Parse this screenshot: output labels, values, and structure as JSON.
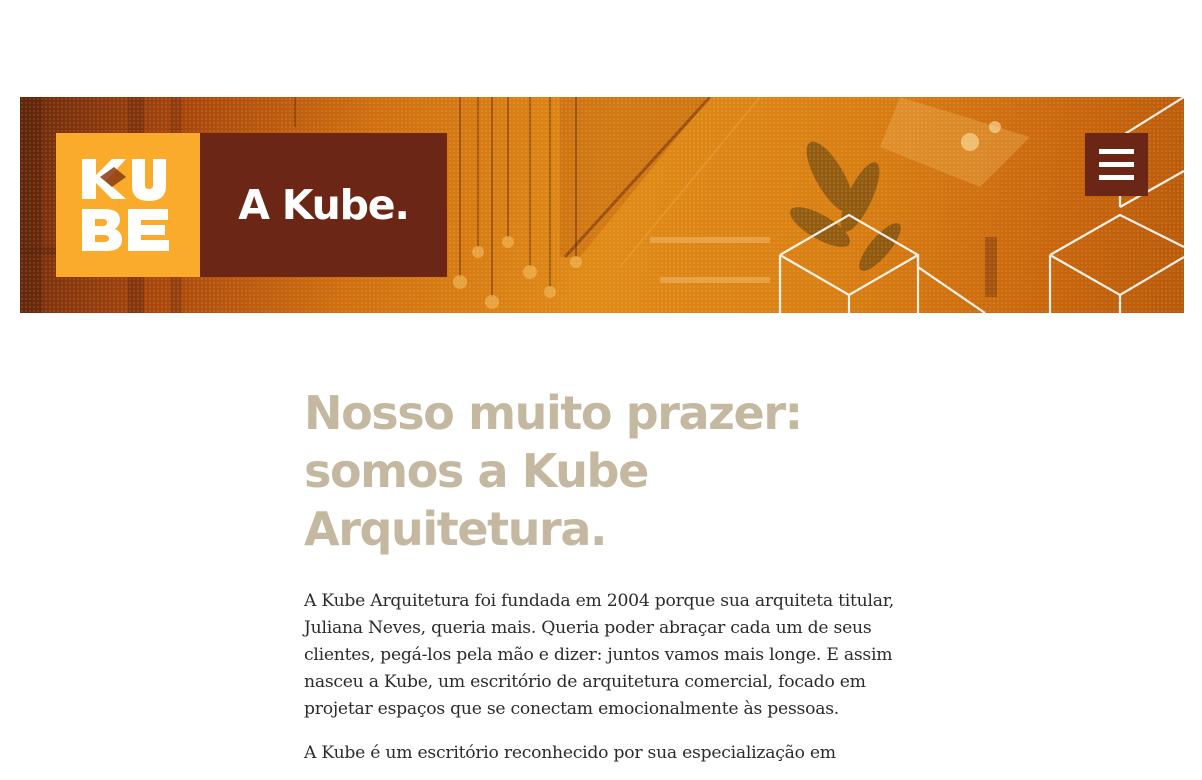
{
  "header": {
    "logo": {
      "alt_text": "KUBE",
      "line1": "KU",
      "line2": "BE"
    },
    "brand_title": "A Kube.",
    "menu_icon": "hamburger-menu-icon"
  },
  "main": {
    "heading_lines": [
      "Nosso muito prazer:",
      "somos a Kube",
      "Arquitetura."
    ],
    "paragraphs": [
      [
        "A Kube Arquitetura foi fundada em 2004 porque sua arquiteta titular,",
        "Juliana Neves, queria mais. Queria poder abraçar cada um de seus",
        "clientes, pegá-los pela mão e dizer: juntos vamos mais longe. E assim",
        "nasceu a Kube, um escritório de arquitetura comercial, focado em",
        "projetar espaços que se conectam emocionalmente às pessoas."
      ],
      [
        "A Kube é um escritório reconhecido por sua especialização em"
      ]
    ]
  },
  "colors": {
    "logo_background": "#fbab2b",
    "brand_background": "#6b2616",
    "heading": "#c5b8a0",
    "body_text": "#2b2b2b",
    "hero_tint": "#d97f12"
  }
}
